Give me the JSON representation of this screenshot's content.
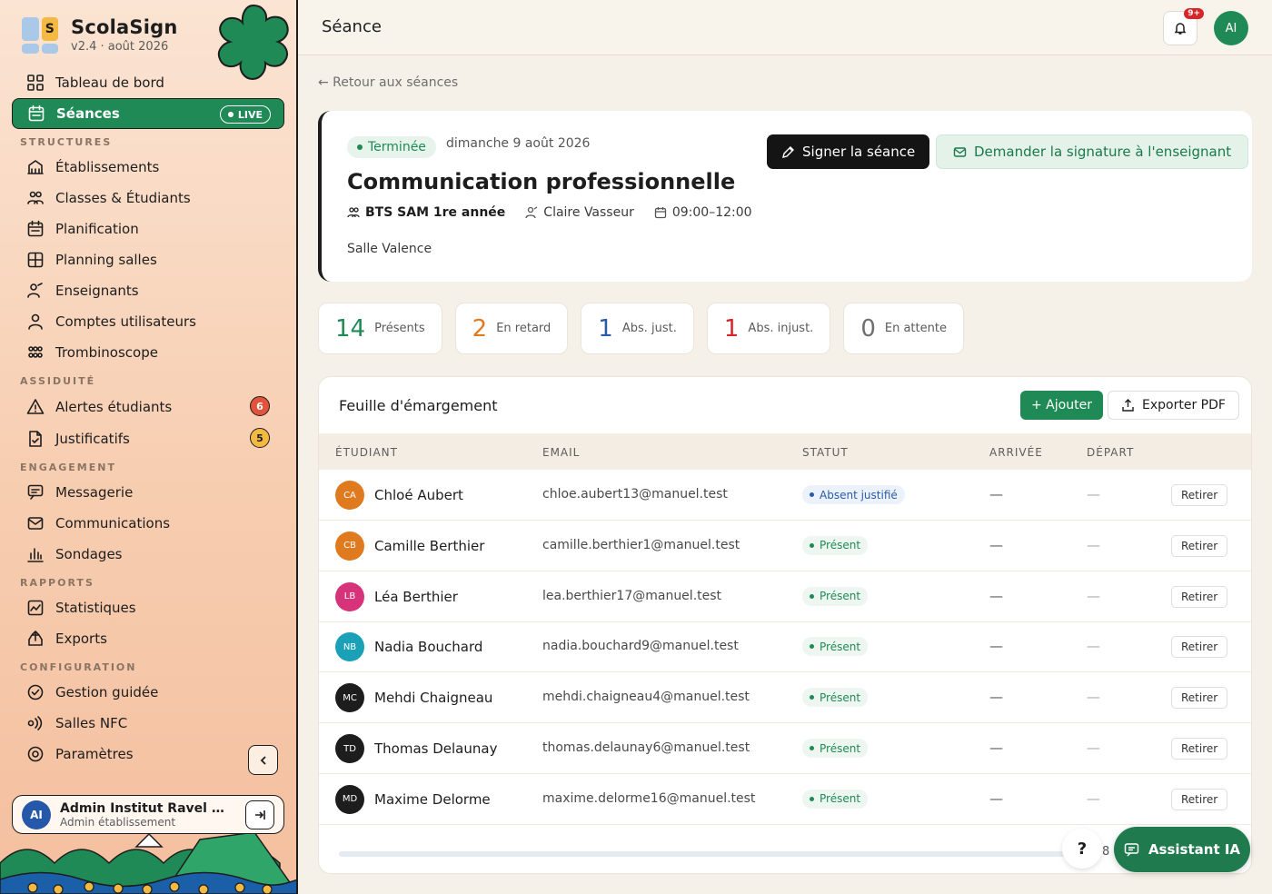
{
  "app": {
    "name": "ScolaSign",
    "version": "v2.4 · août 2026"
  },
  "sidebar": {
    "items_top": [
      {
        "label": "Tableau de bord",
        "icon": "dashboard-icon"
      },
      {
        "label": "Séances",
        "icon": "calendar-icon",
        "badge": "LIVE"
      }
    ],
    "sections": [
      {
        "title": "STRUCTURES",
        "items": [
          {
            "label": "Établissements",
            "icon": "building-icon"
          },
          {
            "label": "Classes & Étudiants",
            "icon": "group-icon"
          },
          {
            "label": "Planification",
            "icon": "calendar-icon"
          },
          {
            "label": "Planning salles",
            "icon": "grid-icon"
          },
          {
            "label": "Enseignants",
            "icon": "teacher-icon"
          },
          {
            "label": "Comptes utilisateurs",
            "icon": "user-icon"
          },
          {
            "label": "Trombinoscope",
            "icon": "faces-icon"
          }
        ]
      },
      {
        "title": "ASSIDUITÉ",
        "items": [
          {
            "label": "Alertes étudiants",
            "icon": "warning-icon",
            "count": "6"
          },
          {
            "label": "Justificatifs",
            "icon": "document-icon",
            "count": "5"
          }
        ]
      },
      {
        "title": "ENGAGEMENT",
        "items": [
          {
            "label": "Messagerie",
            "icon": "message-icon"
          },
          {
            "label": "Communications",
            "icon": "mail-icon"
          },
          {
            "label": "Sondages",
            "icon": "chart-icon"
          }
        ]
      },
      {
        "title": "RAPPORTS",
        "items": [
          {
            "label": "Statistiques",
            "icon": "stats-icon"
          },
          {
            "label": "Exports",
            "icon": "export-icon"
          }
        ]
      },
      {
        "title": "CONFIGURATION",
        "items": [
          {
            "label": "Gestion guidée",
            "icon": "check-circle-icon"
          },
          {
            "label": "Salles NFC",
            "icon": "nfc-icon"
          },
          {
            "label": "Paramètres",
            "icon": "settings-icon"
          }
        ]
      }
    ],
    "user": {
      "initials": "AI",
      "name": "Admin Institut Ravel For...",
      "role": "Admin établissement"
    }
  },
  "header": {
    "title": "Séance",
    "notif_badge": "9+",
    "avatar": "AI"
  },
  "back_link": "← Retour aux séances",
  "session": {
    "status": "Terminée",
    "date": "dimanche 9 août 2026",
    "title": "Communication professionnelle",
    "class": "BTS SAM 1re année",
    "teacher": "Claire Vasseur",
    "time": "09:00–12:00",
    "room": "Salle Valence",
    "sign_label": "Signer la séance",
    "request_label": "Demander la signature à l'enseignant"
  },
  "stats": [
    {
      "value": "14",
      "label": "Présents",
      "color": "#1f8a55"
    },
    {
      "value": "2",
      "label": "En retard",
      "color": "#e07a1f"
    },
    {
      "value": "1",
      "label": "Abs. just.",
      "color": "#2b5aa8"
    },
    {
      "value": "1",
      "label": "Abs. injust.",
      "color": "#d7262a"
    },
    {
      "value": "0",
      "label": "En attente",
      "color": "#6f6f6f"
    }
  ],
  "sheet": {
    "title": "Feuille d'émargement",
    "add_label": "+ Ajouter",
    "export_label": "Exporter PDF",
    "columns": [
      "ÉTUDIANT",
      "EMAIL",
      "STATUT",
      "ARRIVÉE",
      "DÉPART"
    ],
    "rows": [
      {
        "initials": "CA",
        "color": "#e07a1f",
        "name": "Chloé Aubert",
        "email": "chloe.aubert13@manuel.test",
        "status": "Absent justifié",
        "kind": "absj",
        "arrival": "—",
        "departure": "—",
        "action": "Retirer"
      },
      {
        "initials": "CB",
        "color": "#e07a1f",
        "name": "Camille Berthier",
        "email": "camille.berthier1@manuel.test",
        "status": "Présent",
        "kind": "present",
        "arrival": "—",
        "departure": "—",
        "action": "Retirer"
      },
      {
        "initials": "LB",
        "color": "#d6337a",
        "name": "Léa Berthier",
        "email": "lea.berthier17@manuel.test",
        "status": "Présent",
        "kind": "present",
        "arrival": "—",
        "departure": "—",
        "action": "Retirer"
      },
      {
        "initials": "NB",
        "color": "#1aa1b8",
        "name": "Nadia Bouchard",
        "email": "nadia.bouchard9@manuel.test",
        "status": "Présent",
        "kind": "present",
        "arrival": "—",
        "departure": "—",
        "action": "Retirer"
      },
      {
        "initials": "MC",
        "color": "#1d1d1d",
        "name": "Mehdi Chaigneau",
        "email": "mehdi.chaigneau4@manuel.test",
        "status": "Présent",
        "kind": "present",
        "arrival": "—",
        "departure": "—",
        "action": "Retirer"
      },
      {
        "initials": "TD",
        "color": "#1d1d1d",
        "name": "Thomas Delaunay",
        "email": "thomas.delaunay6@manuel.test",
        "status": "Présent",
        "kind": "present",
        "arrival": "—",
        "departure": "—",
        "action": "Retirer"
      },
      {
        "initials": "MD",
        "color": "#1d1d1d",
        "name": "Maxime Delorme",
        "email": "maxime.delorme16@manuel.test",
        "status": "Présent",
        "kind": "present",
        "arrival": "—",
        "departure": "—",
        "action": "Retirer"
      }
    ]
  },
  "floating": {
    "help": "?",
    "help_count": "8",
    "assistant": "Assistant IA"
  }
}
